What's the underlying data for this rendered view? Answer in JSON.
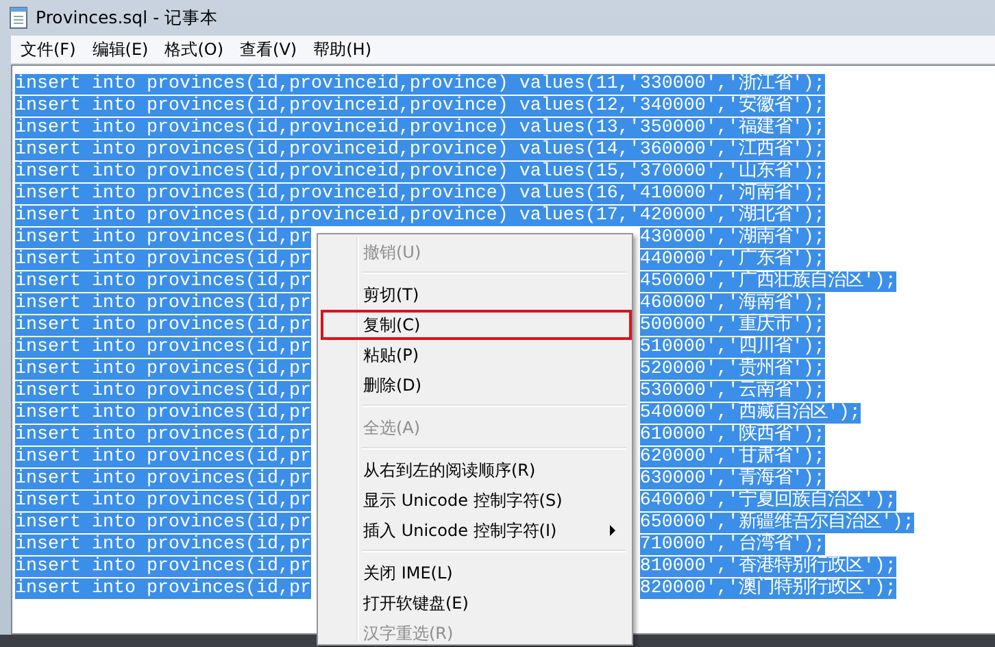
{
  "window": {
    "title": "Provinces.sql - 记事本"
  },
  "menu_bar": [
    {
      "label": "文件(F)"
    },
    {
      "label": "编辑(E)"
    },
    {
      "label": "格式(O)"
    },
    {
      "label": "查看(V)"
    },
    {
      "label": "帮助(H)"
    }
  ],
  "editor": {
    "lines": [
      {
        "kind": "full",
        "text": "insert into provinces(id,provinceid,province) values(11,'330000','浙江省');",
        "selected": true
      },
      {
        "kind": "full",
        "text": "insert into provinces(id,provinceid,province) values(12,'340000','安徽省');",
        "selected": true
      },
      {
        "kind": "full",
        "text": "insert into provinces(id,provinceid,province) values(13,'350000','福建省');",
        "selected": true
      },
      {
        "kind": "full",
        "text": "insert into provinces(id,provinceid,province) values(14,'360000','江西省');",
        "selected": true
      },
      {
        "kind": "full",
        "text": "insert into provinces(id,provinceid,province) values(15,'370000','山东省');",
        "selected": true
      },
      {
        "kind": "full",
        "text": "insert into provinces(id,provinceid,province) values(16,'410000','河南省');",
        "selected": true
      },
      {
        "kind": "full",
        "text": "insert into provinces(id,provinceid,province) values(17,'420000','湖北省');",
        "selected": true
      },
      {
        "kind": "split",
        "left": "insert into provinces(id,pr",
        "right": "430000','湖南省');",
        "selected": true
      },
      {
        "kind": "split",
        "left": "insert into provinces(id,pr",
        "right": "440000','广东省');",
        "selected": true
      },
      {
        "kind": "split",
        "left": "insert into provinces(id,pr",
        "right": "450000','广西壮族自治区');",
        "selected": true
      },
      {
        "kind": "split",
        "left": "insert into provinces(id,pr",
        "right": "460000','海南省');",
        "selected": true
      },
      {
        "kind": "split",
        "left": "insert into provinces(id,pr",
        "right": "500000','重庆市');",
        "selected": true
      },
      {
        "kind": "split",
        "left": "insert into provinces(id,pr",
        "right": "510000','四川省');",
        "selected": true
      },
      {
        "kind": "split",
        "left": "insert into provinces(id,pr",
        "right": "520000','贵州省');",
        "selected": true
      },
      {
        "kind": "split",
        "left": "insert into provinces(id,pr",
        "right": "530000','云南省');",
        "selected": true
      },
      {
        "kind": "split",
        "left": "insert into provinces(id,pr",
        "right": "540000','西藏自治区');",
        "selected": true
      },
      {
        "kind": "split",
        "left": "insert into provinces(id,pr",
        "right": "610000','陕西省');",
        "selected": true
      },
      {
        "kind": "split",
        "left": "insert into provinces(id,pr",
        "right": "620000','甘肃省');",
        "selected": true
      },
      {
        "kind": "split",
        "left": "insert into provinces(id,pr",
        "right": "630000','青海省');",
        "selected": true
      },
      {
        "kind": "split",
        "left": "insert into provinces(id,pr",
        "right": "640000','宁夏回族自治区');",
        "selected": true
      },
      {
        "kind": "split",
        "left": "insert into provinces(id,pr",
        "right": "650000','新疆维吾尔自治区');",
        "selected": true
      },
      {
        "kind": "split",
        "left": "insert into provinces(id,pr",
        "right": "710000','台湾省');",
        "selected": true
      },
      {
        "kind": "split",
        "left": "insert into provinces(id,pr",
        "right": "810000','香港特别行政区');",
        "selected": true
      },
      {
        "kind": "split",
        "left": "insert into provinces(id,pr",
        "right": "820000','澳门特别行政区');",
        "selected": true
      }
    ]
  },
  "context_menu": {
    "items": [
      {
        "kind": "item",
        "label": "撤销(U)",
        "disabled": true,
        "annotated": false
      },
      {
        "kind": "separator"
      },
      {
        "kind": "item",
        "label": "剪切(T)",
        "disabled": false,
        "annotated": false
      },
      {
        "kind": "item",
        "label": "复制(C)",
        "disabled": false,
        "annotated": true
      },
      {
        "kind": "item",
        "label": "粘贴(P)",
        "disabled": false,
        "annotated": false
      },
      {
        "kind": "item",
        "label": "删除(D)",
        "disabled": false,
        "annotated": false
      },
      {
        "kind": "separator"
      },
      {
        "kind": "item",
        "label": "全选(A)",
        "disabled": true,
        "annotated": false
      },
      {
        "kind": "separator"
      },
      {
        "kind": "item",
        "label": "从右到左的阅读顺序(R)",
        "disabled": false,
        "annotated": false
      },
      {
        "kind": "item",
        "label": "显示 Unicode 控制字符(S)",
        "disabled": false,
        "annotated": false
      },
      {
        "kind": "submenu",
        "label": "插入 Unicode 控制字符(I)",
        "disabled": false,
        "annotated": false
      },
      {
        "kind": "separator"
      },
      {
        "kind": "item",
        "label": "关闭 IME(L)",
        "disabled": false,
        "annotated": false
      },
      {
        "kind": "item",
        "label": "打开软键盘(E)",
        "disabled": false,
        "annotated": false
      },
      {
        "kind": "item",
        "label": "汉字重选(R)",
        "disabled": true,
        "annotated": false
      }
    ]
  }
}
